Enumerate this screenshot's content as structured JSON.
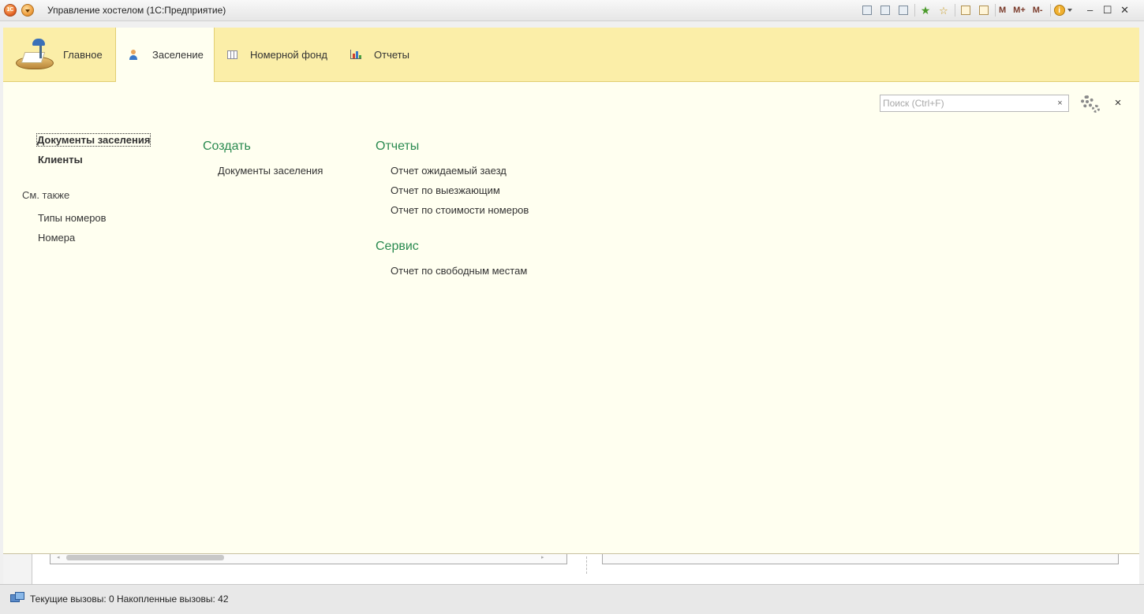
{
  "window": {
    "title": "Управление хостелом  (1С:Предприятие)",
    "logo_text": "1С",
    "toolbar_icons": [
      "save-icon",
      "print-icon",
      "print-preview-icon",
      "add-favorite-icon",
      "favorites-icon",
      "calculator-icon",
      "calendar-icon"
    ],
    "memory_buttons": {
      "m": "M",
      "m_plus": "M+",
      "m_minus": "M-"
    },
    "info_glyph": "i",
    "controls": {
      "minimize": "–",
      "maximize": "☐",
      "close": "✕"
    }
  },
  "sections": [
    {
      "label": "Главное",
      "icon": "desk-lamp-icon",
      "active": false
    },
    {
      "label": "Заселение",
      "icon": "person-icon",
      "active": true
    },
    {
      "label": "Номерной фонд",
      "icon": "grid-table-icon",
      "active": false
    },
    {
      "label": "Отчеты",
      "icon": "bar-chart-icon",
      "active": false
    }
  ],
  "search": {
    "placeholder": "Поиск (Ctrl+F)",
    "value": "",
    "clear": "×"
  },
  "panel_close": "×",
  "navigation": {
    "items": [
      {
        "label": "Документы заселения",
        "bold": true,
        "selected": true
      },
      {
        "label": "Клиенты",
        "bold": true,
        "selected": false
      }
    ],
    "see_also_title": "См. также",
    "see_also": [
      {
        "label": "Типы номеров"
      },
      {
        "label": "Номера"
      }
    ]
  },
  "create": {
    "title": "Создать",
    "items": [
      {
        "label": "Документы заселения"
      }
    ]
  },
  "reports": {
    "title": "Отчеты",
    "items": [
      {
        "label": "Отчет ожидаемый заезд"
      },
      {
        "label": "Отчет по выезжающим"
      },
      {
        "label": "Отчет по стоимости номеров"
      }
    ]
  },
  "service": {
    "title": "Сервис",
    "items": [
      {
        "label": "Отчет по свободным местам"
      }
    ]
  },
  "status_bar": {
    "text": "Текущие вызовы: 0   Накопленные вызовы: 42"
  },
  "colors": {
    "sections_bg": "#fbeea8",
    "content_bg": "#fffff0",
    "group_title": "#2a8a50"
  }
}
